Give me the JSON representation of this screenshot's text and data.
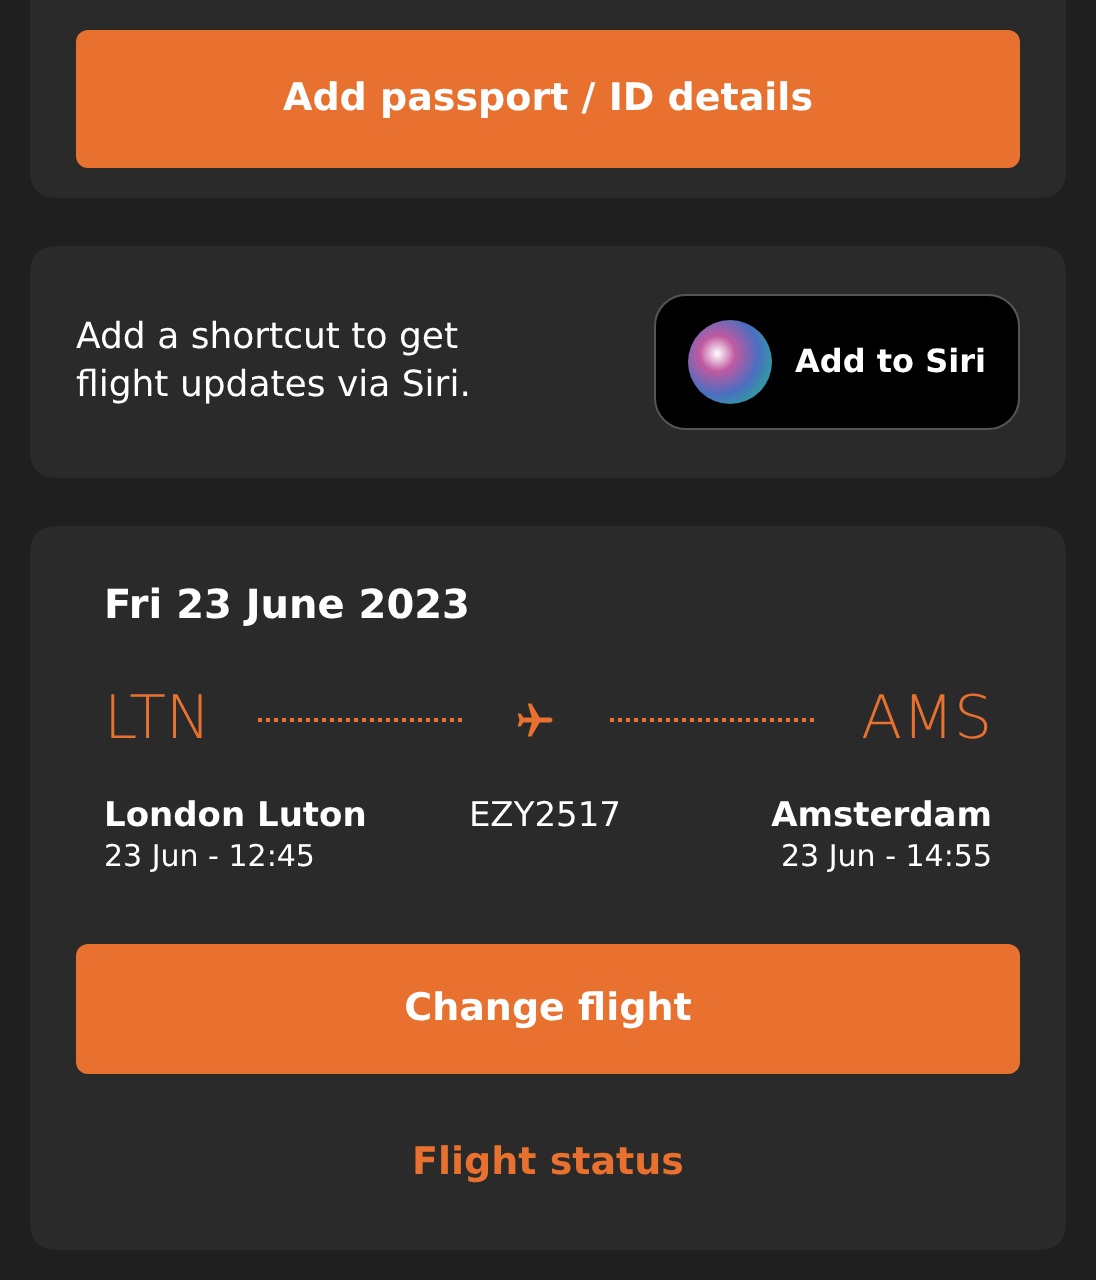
{
  "passport_card": {
    "button": "Add passport / ID details"
  },
  "siri_card": {
    "text": "Add a shortcut to get flight updates via Siri.",
    "button": "Add to Siri"
  },
  "flight_card": {
    "date": "Fri 23 June 2023",
    "origin": {
      "code": "LTN",
      "name": "London Luton",
      "time": "23 Jun - 12:45"
    },
    "flight_number": "EZY2517",
    "destination": {
      "code": "AMS",
      "name": "Amsterdam",
      "time": "23 Jun - 14:55"
    },
    "primary_button": "Change flight",
    "link": "Flight status"
  }
}
